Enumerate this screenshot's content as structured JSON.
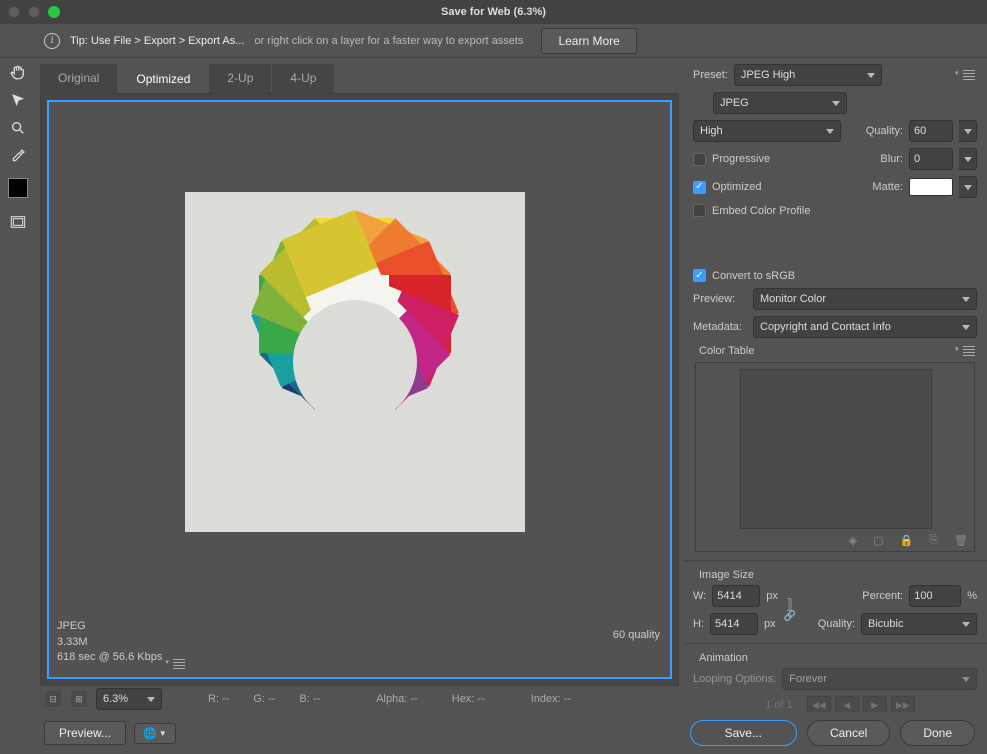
{
  "window": {
    "title": "Save for Web (6.3%)"
  },
  "tip": {
    "strong": "Tip: Use File > Export > Export As...",
    "rest": "or right click on a layer for a faster way to export assets",
    "learn": "Learn More"
  },
  "tabs": [
    "Original",
    "Optimized",
    "2-Up",
    "4-Up"
  ],
  "active_tab": 1,
  "preview_info": {
    "format": "JPEG",
    "size": "3.33M",
    "time": "618 sec @ 56.6 Kbps",
    "quality": "60 quality"
  },
  "preset": {
    "label": "Preset:",
    "value": "JPEG High",
    "format": "JPEG",
    "quality_preset": "High",
    "quality_label": "Quality:",
    "quality_value": "60",
    "progressive": "Progressive",
    "progressive_checked": false,
    "blur_label": "Blur:",
    "blur_value": "0",
    "optimized": "Optimized",
    "optimized_checked": true,
    "matte_label": "Matte:",
    "embed": "Embed Color Profile",
    "embed_checked": false
  },
  "color": {
    "convert": "Convert to sRGB",
    "convert_checked": true,
    "preview_label": "Preview:",
    "preview_value": "Monitor Color",
    "meta_label": "Metadata:",
    "meta_value": "Copyright and Contact Info",
    "table_label": "Color Table"
  },
  "image_size": {
    "head": "Image Size",
    "w_label": "W:",
    "w": "5414",
    "h_label": "H:",
    "h": "5414",
    "px": "px",
    "percent_label": "Percent:",
    "percent": "100",
    "pct_sign": "%",
    "quality_label": "Quality:",
    "quality_value": "Bicubic"
  },
  "animation": {
    "head": "Animation",
    "loop_label": "Looping Options:",
    "loop_value": "Forever",
    "frame": "1 of 1"
  },
  "infobar": {
    "zoom": "6.3%",
    "r": "R: --",
    "g": "G: --",
    "b": "B: --",
    "alpha": "Alpha: --",
    "hex": "Hex: --",
    "index": "Index: --"
  },
  "buttons": {
    "preview": "Preview...",
    "save": "Save...",
    "cancel": "Cancel",
    "done": "Done"
  },
  "wheel_colors": [
    "#f6d738",
    "#f1a23a",
    "#ee7b30",
    "#e94f2a",
    "#d8232a",
    "#cf1f63",
    "#c42688",
    "#8e3a8f",
    "#4a2a6b",
    "#1d3c73",
    "#196a8a",
    "#1a9fa0",
    "#3aa749",
    "#7fb23a",
    "#b7bd2f",
    "#d6c531"
  ]
}
